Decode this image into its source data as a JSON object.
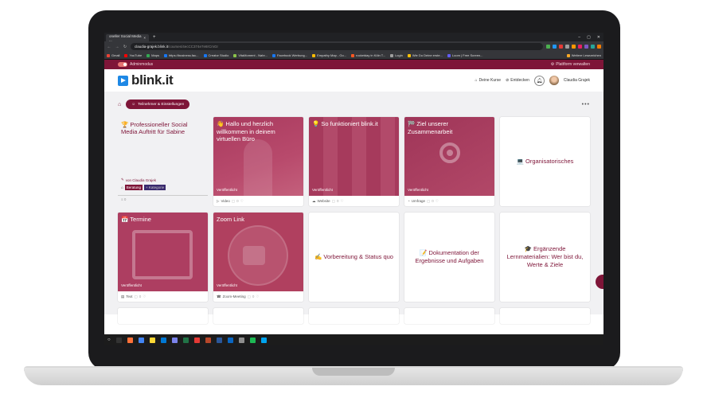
{
  "browser": {
    "tab_title": "oneller Social Media ...",
    "url_host": "claudia-grajek.blink.it",
    "url_path": "/courses/4ecCC374e7e8rCmGr",
    "bookmarks": [
      "Gmail",
      "YouTube",
      "Maps",
      "https://business.fac...",
      "Creator Studio",
      "VitaMoment - Nahr...",
      "Facebook Werbung...",
      "Empathy Map - Go...",
      "rocketday in Köln T...",
      "Login",
      "Wie Du Deine erste...",
      "Loom | Free Screen..."
    ],
    "bookmarks_right": "Weitere Lesezeichen"
  },
  "admin": {
    "mode_label": "Adminmodus",
    "manage_label": "Plattform verwalten"
  },
  "header": {
    "logo": "blink.it",
    "links": [
      "Deine Kurse",
      "Entdecken"
    ],
    "user_name": "Claudia Grajek"
  },
  "toolbar": {
    "participants_label": "Teilnehmer & Einstellungen"
  },
  "course": {
    "title": "🏆 Professioneller Social Media Auftritt für Sabine",
    "author": "von Claudia Grajek",
    "tags": [
      "Beratung",
      "+ Kategorie"
    ],
    "count": "0"
  },
  "cards_row1": [
    {
      "title": "👋 Hallo und herzlich willkommen in deinem virtuellen Büro",
      "status": "Veröffentlicht",
      "type": "Video",
      "count": "0"
    },
    {
      "title": "💡 So funktioniert blink.it",
      "status": "Veröffentlicht",
      "type": "Website",
      "count": "0"
    },
    {
      "title": "🏁 Ziel unserer Zusammenarbeit",
      "status": "Veröffentlicht",
      "type": "Umfrage",
      "count": "0"
    },
    {
      "title": "💻 Organisatorisches"
    }
  ],
  "cards_row2": [
    {
      "title": "📅 Termine",
      "status": "Veröffentlicht",
      "type": "Text",
      "count": "0"
    },
    {
      "title": "Zoom Link",
      "status": "Veröffentlicht",
      "type": "Zoom-Meeting",
      "count": "0"
    },
    {
      "title": "✍️ Vorbereitung & Status quo"
    },
    {
      "title": "📝 Dokumentation der Ergebnisse und Aufgaben"
    },
    {
      "title": "🎓 Ergänzende Lernmaterialien: Wer bist du, Werte & Ziele"
    }
  ],
  "colors": {
    "primary": "#7e1538",
    "card_bg": "#b04264",
    "page_bg": "#f1f1f3"
  }
}
